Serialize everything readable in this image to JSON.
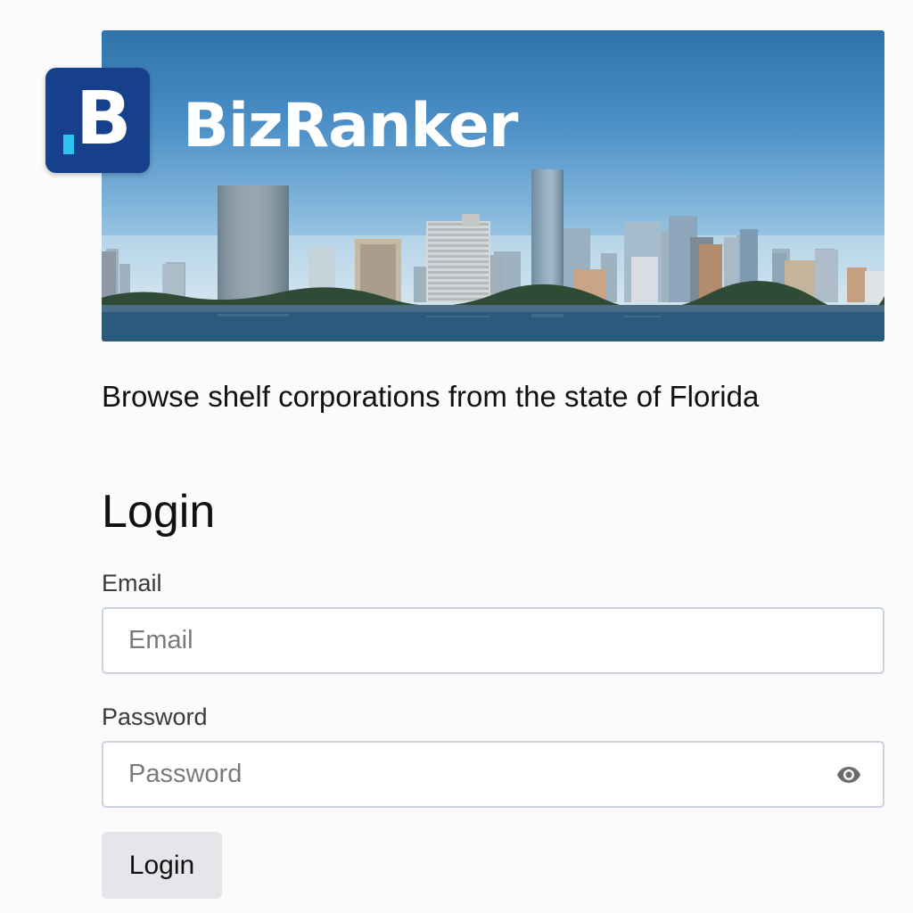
{
  "brand": {
    "logo_letter": "B",
    "name": "BizRanker",
    "logo_color": "#163f8c",
    "logo_accent": "#2ec4f1"
  },
  "hero": {
    "image": "city-skyline-waterfront"
  },
  "tagline": "Browse shelf corporations from the state of Florida",
  "login": {
    "title": "Login",
    "email": {
      "label": "Email",
      "placeholder": "Email",
      "value": ""
    },
    "password": {
      "label": "Password",
      "placeholder": "Password",
      "value": "",
      "toggle_icon": "eye-icon"
    },
    "button_label": "Login"
  }
}
